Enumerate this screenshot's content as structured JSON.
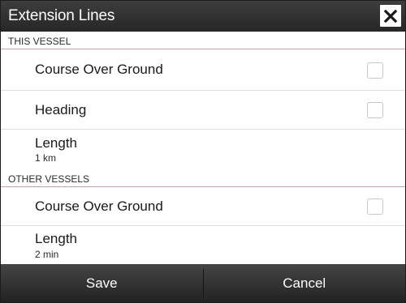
{
  "dialog": {
    "title": "Extension Lines",
    "close_icon": "close-icon"
  },
  "this_vessel": {
    "header": "THIS VESSEL",
    "items": [
      {
        "label": "Course Over Ground",
        "checked": false
      },
      {
        "label": "Heading",
        "checked": false
      }
    ],
    "length": {
      "label": "Length",
      "value": "1 km"
    }
  },
  "other_vessels": {
    "header": "OTHER VESSELS",
    "items": [
      {
        "label": "Course Over Ground",
        "checked": false
      }
    ],
    "length": {
      "label": "Length",
      "value": "2 min"
    }
  },
  "footer": {
    "save_label": "Save",
    "cancel_label": "Cancel"
  }
}
